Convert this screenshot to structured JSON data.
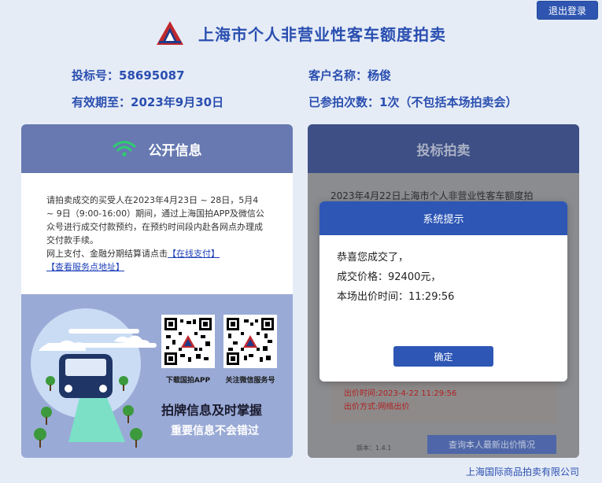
{
  "header": {
    "title": "上海市个人非营业性客车额度拍卖",
    "logout_label": "退出登录"
  },
  "info": {
    "bid_no_label": "投标号：",
    "bid_no": "58695087",
    "customer_label": "客户名称：",
    "customer": "杨俊",
    "valid_label": "有效期至：",
    "valid": "2023年9月30日",
    "count_label": "已参拍次数：",
    "count": "1次（不包括本场拍卖会）"
  },
  "left_panel": {
    "title": "公开信息",
    "notice": "请拍卖成交的买受人在2023年4月23日 ~ 28日，5月4 ~ 9日（9:00-16:00）期间，通过上海国拍APP及微信公众号进行成交付款预约，在预约时间段内赴各网点办理成交付款手续。",
    "pay_prefix": "网上支付、金融分期结算请点击",
    "online_pay_link": "【在线支付】",
    "service_link": "【查看服务点地址】",
    "qr1_caption": "下载国拍APP",
    "qr2_caption": "关注微信服务号",
    "slogan1": "拍牌信息及时掌握",
    "slogan2": "重要信息不会错过"
  },
  "right_panel": {
    "title": "投标拍卖",
    "auction_line": "2023年4月22日上海市个人非营业性客车额度拍",
    "bid_time": "出价时间:2023-4-22 11:29:56",
    "bid_method": "出价方式:网络出价",
    "version": "版本：1.4.1",
    "query_button": "查询本人最新出价情况"
  },
  "modal": {
    "title": "系统提示",
    "line1": "恭喜您成交了，",
    "line2": "成交价格：92400元，",
    "line3": "本场出价时间：11:29:56",
    "ok_label": "确定"
  },
  "footer": {
    "company": "上海国际商品拍卖有限公司"
  },
  "colors": {
    "brand": "#2a4fb0",
    "modal_head": "#2d56b5",
    "wifi": "#2ecc71",
    "alert_red": "#b02020"
  }
}
